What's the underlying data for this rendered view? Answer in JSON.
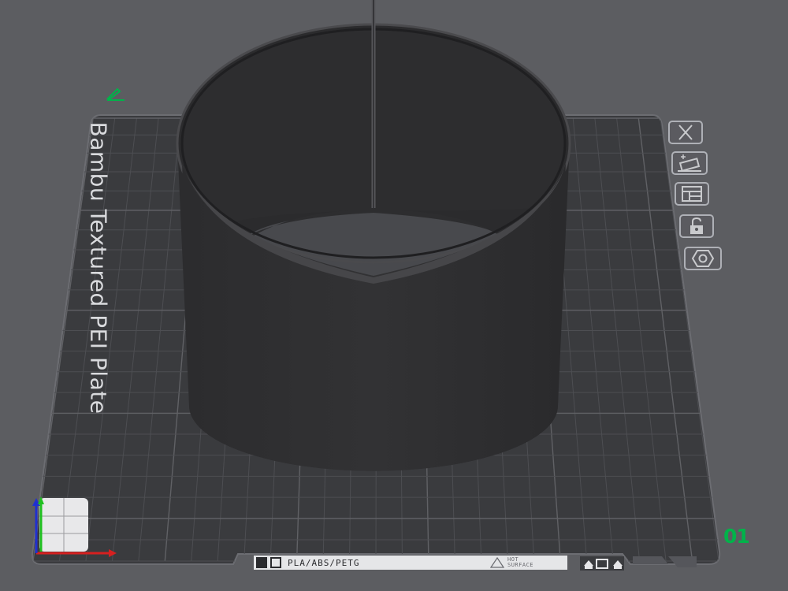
{
  "plate": {
    "name": "Bambu Textured PEI Plate",
    "number": "01",
    "material_text": "PLA/ABS/PETG",
    "hot_surface_text": "HOT\nSURFACE"
  },
  "toolbar": {
    "items": [
      {
        "id": "close",
        "icon": "close-icon"
      },
      {
        "id": "auto-orient",
        "icon": "auto-orient-icon"
      },
      {
        "id": "arrange",
        "icon": "arrange-icon"
      },
      {
        "id": "lock",
        "icon": "lock-icon"
      },
      {
        "id": "settings",
        "icon": "hex-nut-icon"
      }
    ]
  },
  "colors": {
    "background": "#5c5d61",
    "plate": "#3b3c3f",
    "grid": "#55565a",
    "model": "#2f2f31",
    "accent_green": "#00b34a",
    "axis_x": "#d62020",
    "axis_y": "#20c020",
    "axis_z": "#2030d0"
  }
}
